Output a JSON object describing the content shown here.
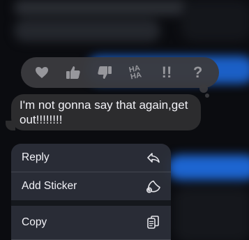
{
  "message": {
    "text": "I'm not gonna say that again,get out!!!!!!!!"
  },
  "tapback": {
    "reactions": [
      {
        "name": "heart",
        "icon": "heart-icon"
      },
      {
        "name": "thumbs-up",
        "icon": "thumbs-up-icon"
      },
      {
        "name": "thumbs-down",
        "icon": "thumbs-down-icon"
      },
      {
        "name": "haha",
        "label_top": "HA",
        "label_bottom": "HA"
      },
      {
        "name": "emphasize",
        "label": "!!"
      },
      {
        "name": "question",
        "label": "?"
      }
    ]
  },
  "menu": {
    "items": [
      {
        "label": "Reply",
        "icon": "reply-arrow-icon"
      },
      {
        "label": "Add Sticker",
        "icon": "sticker-icon"
      },
      {
        "label": "Copy",
        "icon": "copy-icon"
      }
    ]
  },
  "colors": {
    "bubble": "#2c2c2e",
    "tapback_bar": "#3a3a3e",
    "icon_gray": "#97979c",
    "menu_bg": "#2c303a",
    "text": "#f2f2f7",
    "background": "#0b0c10",
    "blur_blue": "#1f6fe6"
  }
}
